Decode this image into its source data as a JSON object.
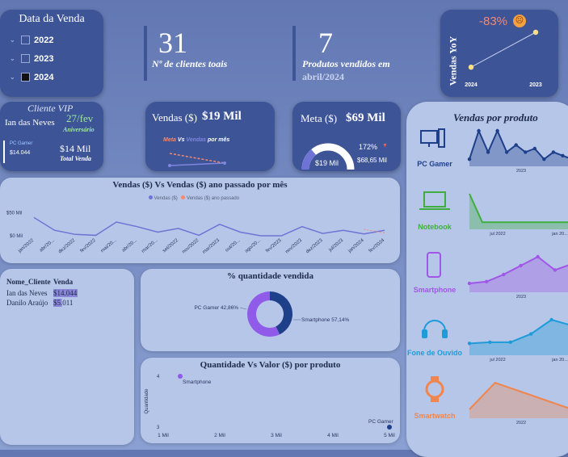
{
  "slicer": {
    "title": "Data da Venda",
    "years": [
      {
        "label": "2022",
        "checked": false
      },
      {
        "label": "2023",
        "checked": false
      },
      {
        "label": "2024",
        "checked": true
      }
    ]
  },
  "kpi_clients": {
    "value": "31",
    "label": "Nº de clientes toais"
  },
  "kpi_products": {
    "value": "7",
    "label_line1": "Produtos vendidos em",
    "label_line2": "abril/2024"
  },
  "yoy": {
    "title": "Vendas YoY",
    "pct": "-83%",
    "x_labels": [
      "2024",
      "2023"
    ]
  },
  "vip": {
    "title": "Cliente VIP",
    "name": "Ian das Neves",
    "date": "27/fev",
    "date_note": "Aniversário",
    "product": "PC Gamer",
    "product_value": "$14.044",
    "total_value": "$14 Mil",
    "total_label": "Total Venda"
  },
  "vendas_card": {
    "label": "Vendas ($)",
    "value": "$19 Mil",
    "meta_word": "Meta",
    "vs_word": "Vs",
    "vendas_word": "Vendas",
    "por_mes": "por mês"
  },
  "meta_card": {
    "label": "Meta ($)",
    "value": "$69 Mil",
    "gauge_value": "$19 Mil",
    "gauge_target": "$68,65 Mil",
    "pct": "172%",
    "fraction": 0.28
  },
  "line_chart": {
    "title": "Vendas ($) Vs Vendas ($) ano passado por mês",
    "legend": [
      "Vendas ($)",
      "Vendas ($) ano passado"
    ],
    "y_ticks": [
      "$50 Mil",
      "$0 Mil"
    ],
    "x_labels": [
      "jan/2022",
      "abr/20...",
      "dez/2022",
      "fev/2022",
      "mai/20...",
      "abr/20...",
      "mar/20...",
      "set/2022",
      "nov/2022",
      "mar/2023",
      "out/20...",
      "ago/20...",
      "fev/2023",
      "nov/2023",
      "dez/2023",
      "jul/2023",
      "jan/2024",
      "fev/2024"
    ]
  },
  "table": {
    "headers": [
      "Nome_Cliente",
      "Venda"
    ],
    "rows": [
      [
        "Ian das Neves",
        "$14.044"
      ],
      [
        "Danilo Araújo",
        "$5.011"
      ]
    ]
  },
  "donut": {
    "title": "% quantidade vendida",
    "labels": [
      "PC Gamer 42,86%",
      "Smartphone 57,14%"
    ]
  },
  "scatter": {
    "title": "Quantidade Vs Valor ($) por produto",
    "ylabel": "Quantidade",
    "x_ticks": [
      "1 Mil",
      "2 Mil",
      "3 Mil",
      "4 Mil",
      "5 Mil"
    ],
    "y_ticks": [
      "4",
      "3"
    ],
    "labels": [
      "Smartphone",
      "PC Gamer"
    ]
  },
  "products": {
    "title": "Vendas por produto",
    "items": [
      {
        "name": "PC Gamer",
        "axis": [
          "2023"
        ]
      },
      {
        "name": "Notebook",
        "axis": [
          "jul 2022",
          "jan 20..."
        ]
      },
      {
        "name": "Smartphone",
        "axis": [
          "2023"
        ]
      },
      {
        "name": "Fone de Ouvido",
        "axis": [
          "jul 2022",
          "jan 20..."
        ]
      },
      {
        "name": "Smartwatch",
        "axis": [
          "2022"
        ]
      }
    ]
  },
  "colors": {
    "dark_card": "#3d5496",
    "light_card": "#b6c6e8",
    "series_main": "#6f73d6",
    "series_prev": "#f28a72",
    "accent_purple": "#8f5be8",
    "pc": "#1e3f8a",
    "notebook": "#3fae3f",
    "smartphone": "#a056e6",
    "fone": "#1e9bd8",
    "smartwatch": "#f0864e"
  },
  "chart_data": [
    {
      "type": "line",
      "title": "Vendas ($) Vs Vendas ($) ano passado por mês",
      "x": [
        "jan/2022",
        "abr/20...",
        "dez/2022",
        "fev/2022",
        "mai/20...",
        "abr/20...",
        "mar/20...",
        "set/2022",
        "nov/2022",
        "mar/2023",
        "out/20...",
        "ago/20...",
        "fev/2023",
        "nov/2023",
        "dez/2023",
        "jul/2023",
        "jan/2024",
        "fev/2024"
      ],
      "series": [
        {
          "name": "Vendas ($)",
          "values": [
            40,
            12,
            3,
            1,
            30,
            20,
            8,
            16,
            1,
            25,
            8,
            0,
            0,
            20,
            5,
            12,
            4,
            12
          ]
        },
        {
          "name": "Vendas ($) ano passado",
          "values": [
            null,
            null,
            null,
            null,
            null,
            null,
            null,
            null,
            null,
            null,
            35,
            null,
            null,
            25,
            null,
            null,
            14,
            6
          ]
        }
      ]
    },
    {
      "type": "line",
      "title": "Vendas YoY",
      "x": [
        "2024",
        "2023"
      ],
      "values": [
        19,
        112
      ]
    },
    {
      "type": "pie",
      "title": "% quantidade vendida",
      "categories": [
        "PC Gamer",
        "Smartphone"
      ],
      "values": [
        42.86,
        57.14
      ]
    },
    {
      "type": "scatter",
      "title": "Quantidade Vs Valor ($) por produto",
      "xlabel": "",
      "ylabel": "Quantidade",
      "points": [
        {
          "name": "Smartphone",
          "x": 1.3,
          "y": 4
        },
        {
          "name": "PC Gamer",
          "x": 5,
          "y": 3
        }
      ]
    },
    {
      "type": "area",
      "title": "PC Gamer",
      "values": [
        1,
        5,
        2,
        5,
        2,
        3,
        2,
        2.5,
        1,
        2,
        1.5,
        1
      ]
    },
    {
      "type": "area",
      "title": "Notebook",
      "values": [
        5,
        1,
        1,
        1,
        1,
        1,
        1,
        1,
        1
      ]
    },
    {
      "type": "area",
      "title": "Smartphone",
      "values": [
        1,
        1.2,
        2,
        3,
        4,
        2.5,
        3.2
      ]
    },
    {
      "type": "area",
      "title": "Fone de Ouvido",
      "values": [
        1,
        1.1,
        1.1,
        1.8,
        3,
        2.5
      ]
    },
    {
      "type": "area",
      "title": "Smartwatch",
      "values": [
        1,
        4,
        3,
        2,
        1
      ]
    }
  ]
}
